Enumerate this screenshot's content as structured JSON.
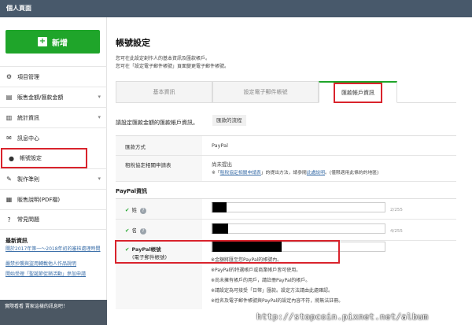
{
  "topbar": {
    "title": "個人頁面"
  },
  "sidebar": {
    "new_label": "新增",
    "items": [
      {
        "label": "項目管理",
        "icon": "gear-icon",
        "glyph": "⚙",
        "chevron": false
      },
      {
        "label": "販售金額/匯款金額",
        "icon": "document-icon",
        "glyph": "▤",
        "chevron": true
      },
      {
        "label": "統計資訊",
        "icon": "chart-icon",
        "glyph": "▥",
        "chevron": true
      },
      {
        "label": "訊息中心",
        "icon": "mail-icon",
        "glyph": "✉",
        "chevron": false
      },
      {
        "label": "帳號設定",
        "icon": "user-icon",
        "glyph": "●",
        "chevron": false
      },
      {
        "label": "製作準則",
        "icon": "pencil-icon",
        "glyph": "✎",
        "chevron": true
      },
      {
        "label": "販售說明(PDF檔)",
        "icon": "book-icon",
        "glyph": "▦",
        "chevron": false
      },
      {
        "label": "常見問題",
        "icon": "question-icon",
        "glyph": "?",
        "chevron": false
      }
    ],
    "news_title": "最新資訊",
    "news": [
      "關於2017年第一～2018年初的審核處理時間",
      "嚴禁抄襲與盜用轉載他人作品說明",
      "開始受理「聖誕節促銷活動」參加申請"
    ],
    "banner_text": "實際看看 賣家這樣的訊息吧！"
  },
  "main": {
    "title": "帳號設定",
    "desc1": "您可在此設定創作人的基本資訊及匯款帳戶。",
    "desc2": "您可在「設定電子郵件帳號」頁面變更電子郵件帳號。",
    "tabs": [
      "基本資訊",
      "設定電子郵件帳號",
      "匯款帳戶資訊"
    ],
    "section_label": "請設定匯款金額的匯款帳戶資訊。",
    "flow_button": "匯款的流程",
    "method_label": "匯款方式",
    "method_value": "PayPal",
    "contract_label": "租稅協定相關申請表",
    "contract_status": "尚未提出",
    "contract_note_pre": "※「",
    "contract_note_link": "租稅協定相關申請表",
    "contract_note_mid": "」的提出方法，請參閱",
    "contract_note_link2": "此處說明",
    "contract_note_post": "。(僅限適用此條約的地區)",
    "paypal_head": "PayPal資訊",
    "last_name_label": "姓",
    "first_name_label": "名",
    "last_counter": "2/255",
    "first_counter": "4/255",
    "paypal_label": "PayPal帳號",
    "paypal_sub": "(電子郵件帳號)",
    "notes": [
      "※金額將匯至您PayPal的帳號內。",
      "※PayPal的特選帳戶或商業帳戶皆可使用。",
      "※尚未擁有帳戶的用戶，請註冊PayPal的帳戶。",
      "※請設定為可接受「日幣」匯款。設定方法請由此處確認。",
      "※姓名及電子郵件帳號與PayPal的設定內容不符，將無法註冊。"
    ]
  },
  "watermark": "http://stopcoin.pixnet.net/album",
  "colors": {
    "accent": "#1fa52a",
    "topbar": "#48596b",
    "highlight": "#d9232c",
    "link": "#3a6ea8"
  }
}
